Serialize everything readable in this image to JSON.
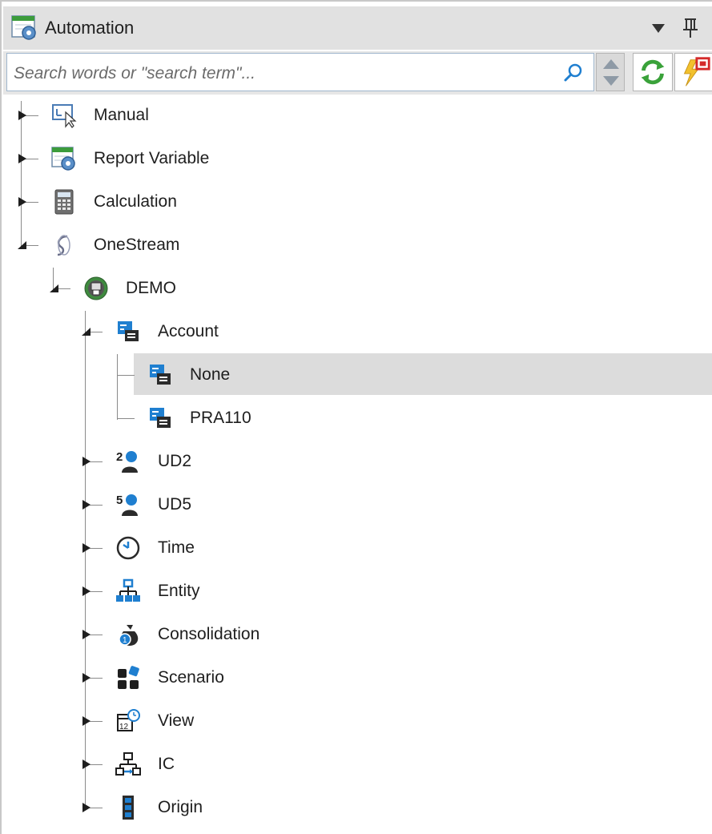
{
  "window": {
    "title": "Automation"
  },
  "search": {
    "placeholder": "Search words or \"search term\"..."
  },
  "tree": {
    "nodes": [
      {
        "label": "Manual",
        "icon": "manual-cursor-icon",
        "expanded": false
      },
      {
        "label": "Report Variable",
        "icon": "report-variable-gear-icon",
        "expanded": false
      },
      {
        "label": "Calculation",
        "icon": "calculator-icon",
        "expanded": false
      },
      {
        "label": "OneStream",
        "icon": "onestream-logo-icon",
        "expanded": true
      },
      {
        "label": "DEMO",
        "icon": "database-connection-icon",
        "expanded": true
      },
      {
        "label": "Account",
        "icon": "account-dimension-icon",
        "expanded": true
      },
      {
        "label": "None",
        "icon": "account-dimension-icon",
        "selected": true
      },
      {
        "label": "PRA110",
        "icon": "account-dimension-icon"
      },
      {
        "label": "UD2",
        "icon": "user-defined-2-icon",
        "expanded": false
      },
      {
        "label": "UD5",
        "icon": "user-defined-5-icon",
        "expanded": false
      },
      {
        "label": "Time",
        "icon": "clock-icon",
        "expanded": false
      },
      {
        "label": "Entity",
        "icon": "hierarchy-icon",
        "expanded": false
      },
      {
        "label": "Consolidation",
        "icon": "money-bag-icon",
        "expanded": false
      },
      {
        "label": "Scenario",
        "icon": "scenario-blocks-icon",
        "expanded": false
      },
      {
        "label": "View",
        "icon": "calendar-clock-icon",
        "expanded": false
      },
      {
        "label": "IC",
        "icon": "intercompany-hierarchy-icon",
        "expanded": false
      },
      {
        "label": "Origin",
        "icon": "origin-stack-icon",
        "expanded": false
      }
    ]
  },
  "colors": {
    "accent_blue": "#1f7fd0",
    "selection": "#dcdcdc",
    "titlebar": "#e1e1e1"
  }
}
